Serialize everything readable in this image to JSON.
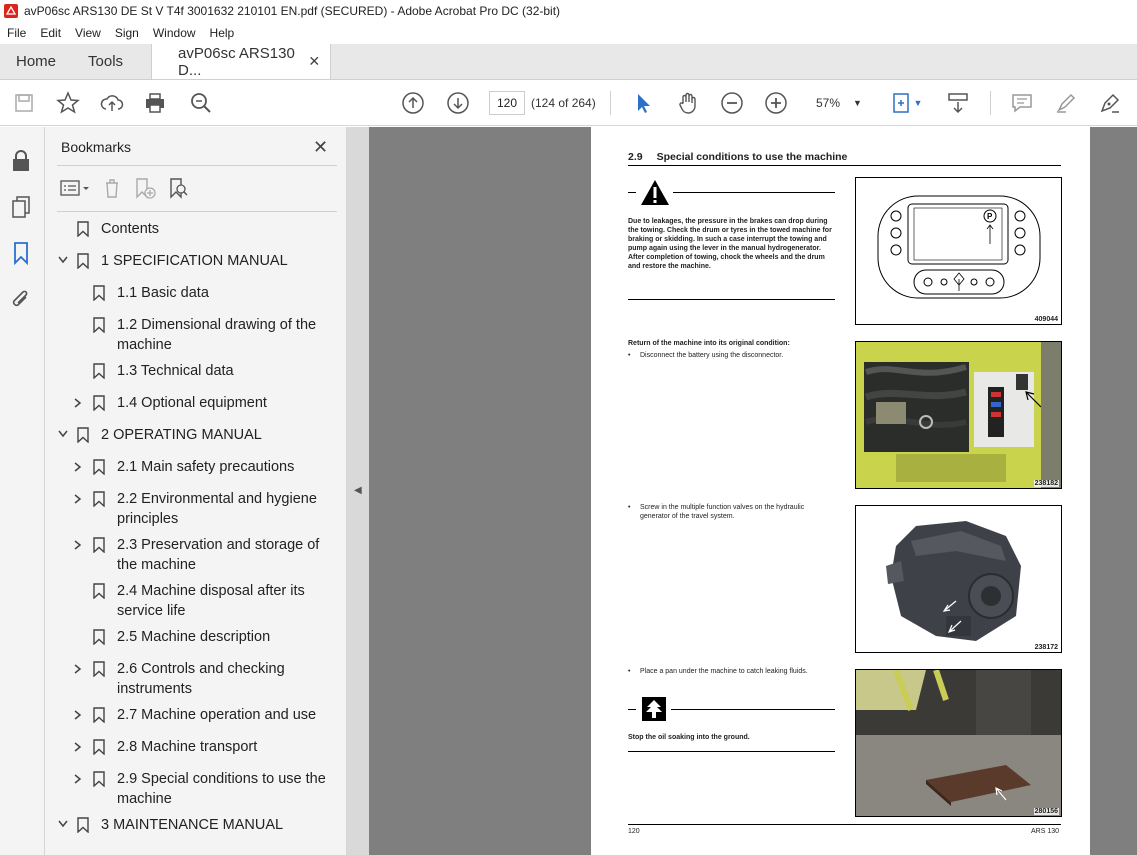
{
  "window": {
    "title": "avP06sc ARS130 DE St V T4f 3001632 210101 EN.pdf (SECURED) - Adobe Acrobat Pro DC (32-bit)"
  },
  "menu": [
    "File",
    "Edit",
    "View",
    "Sign",
    "Window",
    "Help"
  ],
  "tabs": {
    "home": "Home",
    "tools": "Tools",
    "document": "avP06sc ARS130 D...",
    "close": "✕"
  },
  "toolbar": {
    "page_input": "120",
    "page_count": "(124 of 264)",
    "zoom": "57%"
  },
  "bookmarks": {
    "title": "Bookmarks",
    "close": "✕",
    "items": [
      {
        "label": "Contents",
        "level": 0,
        "expand": "none"
      },
      {
        "label": "1 SPECIFICATION MANUAL",
        "level": 0,
        "expand": "open"
      },
      {
        "label": "1.1 Basic data",
        "level": 1,
        "expand": "none"
      },
      {
        "label": "1.2 Dimensional drawing of the machine",
        "level": 1,
        "expand": "none"
      },
      {
        "label": "1.3 Technical data",
        "level": 1,
        "expand": "none"
      },
      {
        "label": "1.4 Optional equipment",
        "level": 1,
        "expand": "closed"
      },
      {
        "label": "2 OPERATING MANUAL",
        "level": 0,
        "expand": "open"
      },
      {
        "label": "2.1 Main safety precautions",
        "level": 1,
        "expand": "closed"
      },
      {
        "label": "2.2 Environmental and hygiene principles",
        "level": 1,
        "expand": "closed"
      },
      {
        "label": "2.3 Preservation and storage of the machine",
        "level": 1,
        "expand": "closed"
      },
      {
        "label": "2.4 Machine disposal after its service life",
        "level": 1,
        "expand": "none"
      },
      {
        "label": "2.5 Machine description",
        "level": 1,
        "expand": "none"
      },
      {
        "label": "2.6 Controls and checking instruments",
        "level": 1,
        "expand": "closed"
      },
      {
        "label": "2.7 Machine operation and use",
        "level": 1,
        "expand": "closed"
      },
      {
        "label": "2.8 Machine transport",
        "level": 1,
        "expand": "closed"
      },
      {
        "label": "2.9 Special conditions to use the machine",
        "level": 1,
        "expand": "closed"
      },
      {
        "label": "3 MAINTENANCE MANUAL",
        "level": 0,
        "expand": "open"
      }
    ]
  },
  "document": {
    "section_number": "2.9",
    "section_title": "Special conditions to use the machine",
    "warning_text": "Due to leakages, the pressure in the brakes can drop during the towing. Check the drum or tyres in the towed machine for braking or skidding. In such a case interrupt the towing and pump again using the lever in the manual hydrogenerator. After completion of towing, chock the wheels and the drum and restore the machine.",
    "return_heading": "Return of the machine into its original condition:",
    "bullet1": "Disconnect the battery using the disconnector.",
    "bullet2": "Screw in the multiple function valves on the hydraulic generator of the travel system.",
    "bullet3": "Place a pan under the machine to catch leaking fluids.",
    "env_text": "Stop the oil soaking into the ground.",
    "fig1": "409044",
    "fig2": "238182",
    "fig3": "238172",
    "fig4": "280156",
    "footer_left": "120",
    "footer_right": "ARS 130"
  }
}
